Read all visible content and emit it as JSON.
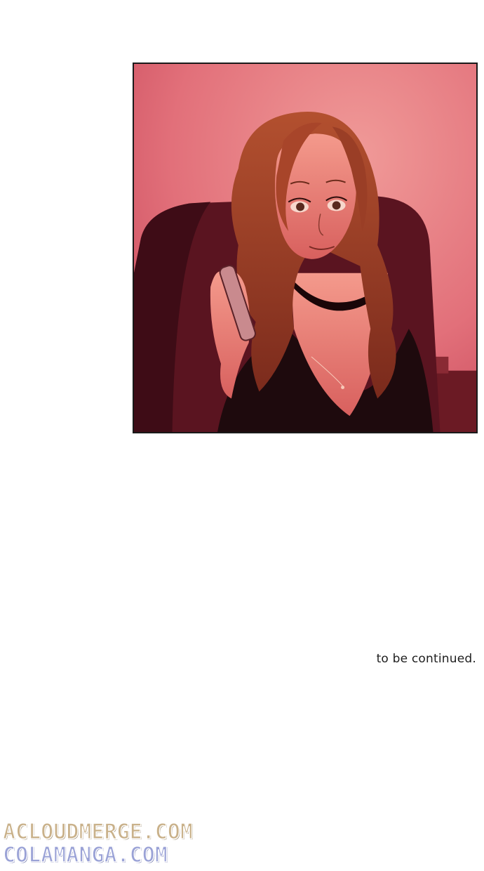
{
  "panel": {
    "scene": "comic-panel-woman-on-phone",
    "colors": {
      "background": "#e8737a",
      "chair": "#5a1420",
      "hair": "#a8452a",
      "skin": "#f08a7d",
      "clothing": "#1e0a0d",
      "phone": "#c98a8e"
    }
  },
  "caption": {
    "text": "to be continued."
  },
  "watermarks": {
    "line1": "ACLOUDMERGE.COM",
    "line2": "COLAMANGA.COM"
  }
}
